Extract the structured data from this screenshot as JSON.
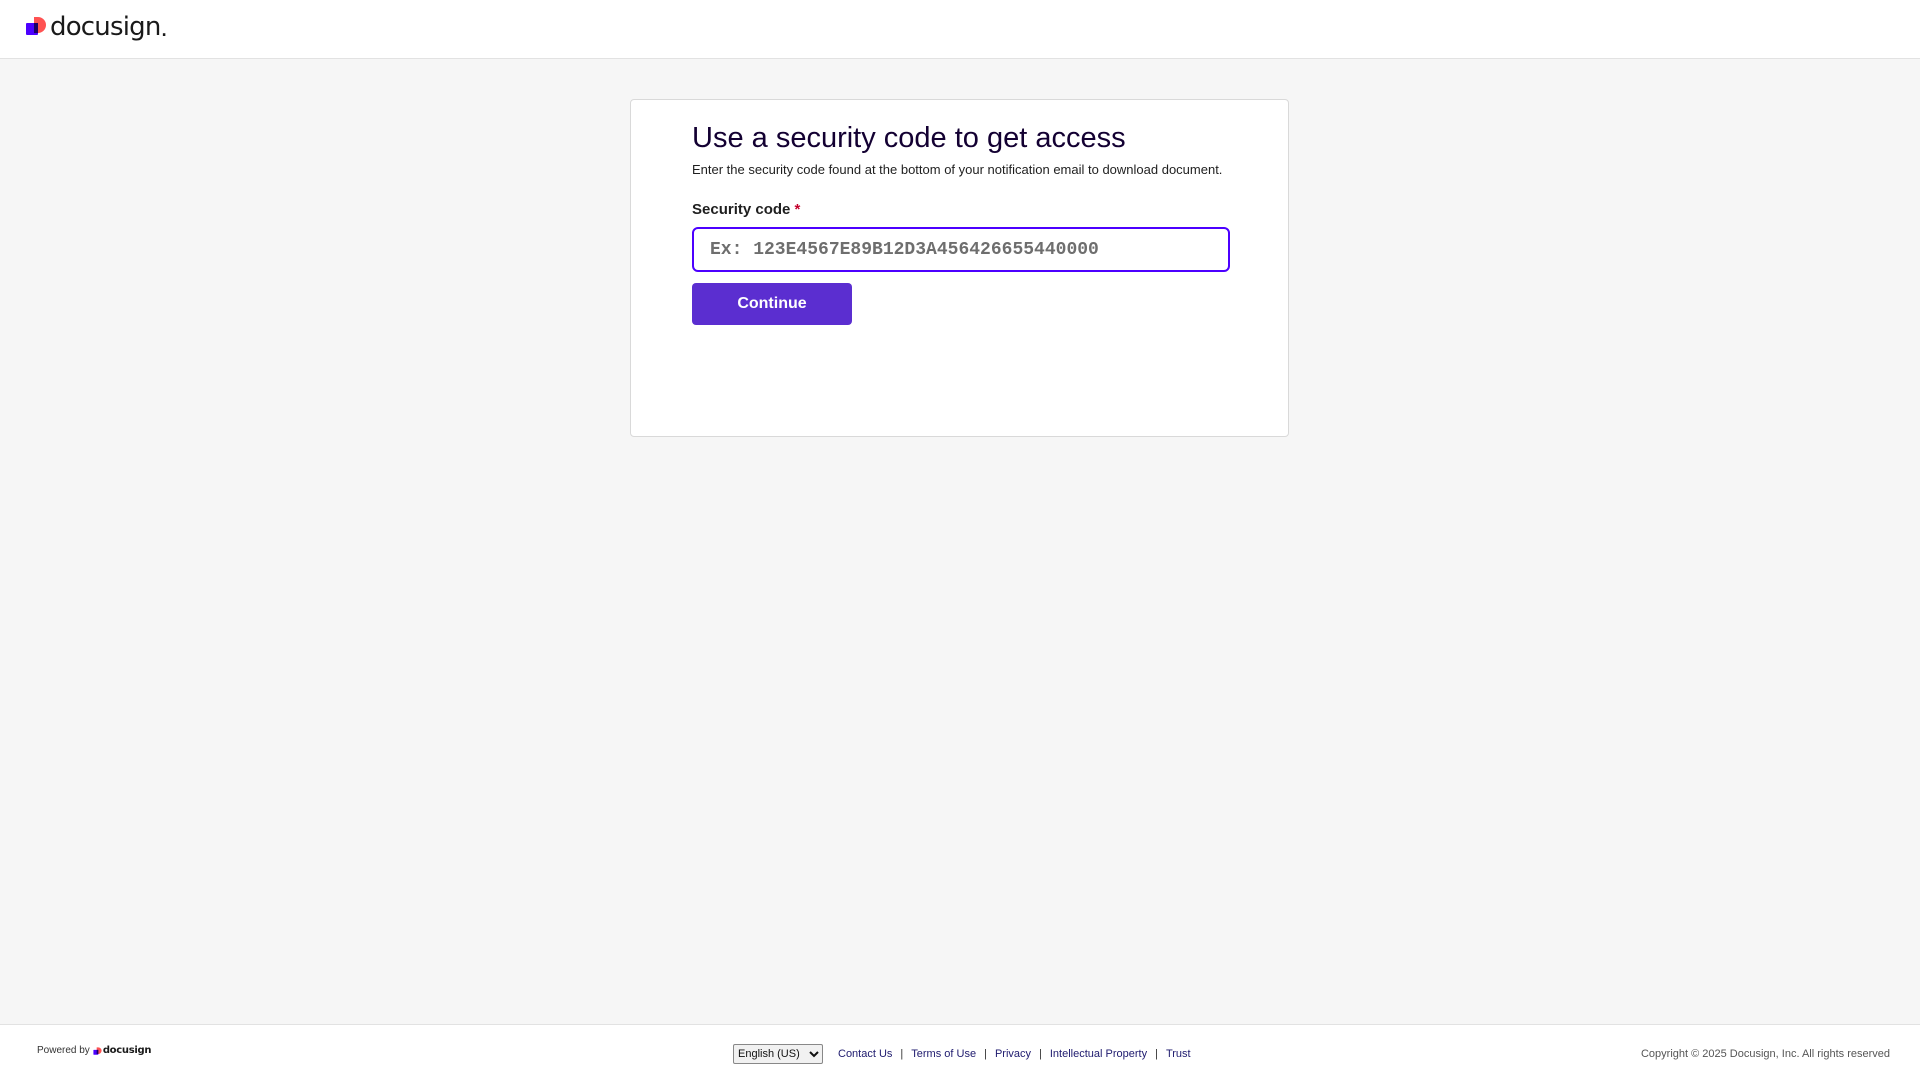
{
  "header": {
    "logo_text": "docusign",
    "logo_dot": ".",
    "logo_colors": {
      "mark_primary": "#4c00ff",
      "mark_accent": "#ff5252"
    }
  },
  "card": {
    "title": "Use a security code to get access",
    "description": "Enter the security code found at the bottom of your notification email to download document.",
    "field_label": "Security code",
    "required_marker": "*",
    "input_value": "",
    "input_placeholder": "Ex: 123E4567E89B12D3A456426655440000",
    "continue_label": "Continue"
  },
  "footer": {
    "powered_text": "Powered by",
    "powered_logo": "docusign",
    "language_selected": "English (US)",
    "links": [
      "Contact Us",
      "Terms of Use",
      "Privacy",
      "Intellectual Property",
      "Trust"
    ],
    "separator": "|",
    "copyright": "Copyright © 2025 Docusign, Inc. All rights reserved"
  },
  "colors": {
    "accent": "#4c00ff",
    "button": "#5b2ed0",
    "title": "#130032",
    "link": "#1e1a6e",
    "required": "#c4002c"
  }
}
